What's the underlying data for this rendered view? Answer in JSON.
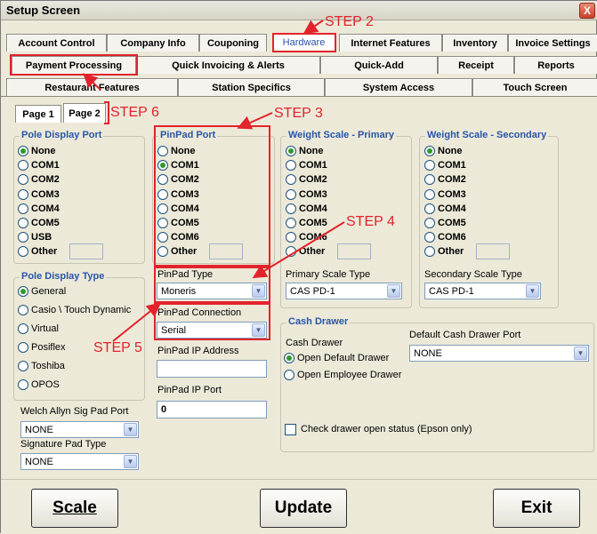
{
  "window": {
    "title": "Setup Screen",
    "close_glyph": "X"
  },
  "tabs_row1": [
    "Account Control",
    "Company Info",
    "Couponing",
    "Hardware",
    "Internet Features",
    "Inventory",
    "Invoice Settings"
  ],
  "tabs_row2": [
    "Payment Processing",
    "Quick Invoicing & Alerts",
    "Quick-Add",
    "Receipt",
    "Reports"
  ],
  "tabs_row3": [
    "Restaurant Features",
    "Station Specifics",
    "System Access",
    "Touch Screen"
  ],
  "pages": [
    "Page 1",
    "Page 2"
  ],
  "pole_display_port": {
    "legend": "Pole Display Port",
    "options": [
      "None",
      "COM1",
      "COM2",
      "COM3",
      "COM4",
      "COM5",
      "USB",
      "Other"
    ],
    "selected": "None"
  },
  "pole_display_type": {
    "legend": "Pole Display Type",
    "options": [
      "General",
      "Casio \\ Touch Dynamic",
      "Virtual",
      "Posiflex",
      "Toshiba",
      "OPOS"
    ],
    "selected": "General"
  },
  "pinpad_port": {
    "legend": "PinPad Port",
    "options": [
      "None",
      "COM1",
      "COM2",
      "COM3",
      "COM4",
      "COM5",
      "COM6",
      "Other"
    ],
    "selected": "COM1"
  },
  "pinpad": {
    "type_label": "PinPad Type",
    "type_value": "Moneris",
    "connection_label": "PinPad Connection",
    "connection_value": "Serial",
    "ip_address_label": "PinPad IP Address",
    "ip_address_value": "",
    "ip_port_label": "PinPad IP Port",
    "ip_port_value": "0"
  },
  "weight_scale_primary": {
    "legend": "Weight Scale - Primary",
    "options": [
      "None",
      "COM1",
      "COM2",
      "COM3",
      "COM4",
      "COM5",
      "COM6",
      "Other"
    ],
    "selected": "None",
    "type_label": "Primary Scale Type",
    "type_value": "CAS PD-1"
  },
  "weight_scale_secondary": {
    "legend": "Weight Scale - Secondary",
    "options": [
      "None",
      "COM1",
      "COM2",
      "COM3",
      "COM4",
      "COM5",
      "COM6",
      "Other"
    ],
    "selected": "None",
    "type_label": "Secondary Scale Type",
    "type_value": "CAS PD-1"
  },
  "cash_drawer": {
    "legend": "Cash Drawer",
    "label": "Cash Drawer",
    "options": [
      "Open Default Drawer",
      "Open Employee Drawer"
    ],
    "selected": "Open Default Drawer",
    "default_port_label": "Default Cash Drawer Port",
    "default_port_value": "NONE",
    "check_label": "Check drawer open status (Epson only)"
  },
  "sig_pad": {
    "welch_label": "Welch Allyn Sig Pad Port",
    "welch_value": "NONE",
    "type_label": "Signature Pad Type",
    "type_value": "NONE"
  },
  "buttons": {
    "scale": "Scale",
    "update": "Update",
    "exit": "Exit"
  },
  "steps": [
    "STEP 2",
    "STEP 3",
    "STEP 4",
    "STEP 5",
    "STEP 6"
  ],
  "colors": {
    "annotation": "#e3232c",
    "legend": "#2a55a8",
    "radio_dot": "#2b9a2b"
  }
}
